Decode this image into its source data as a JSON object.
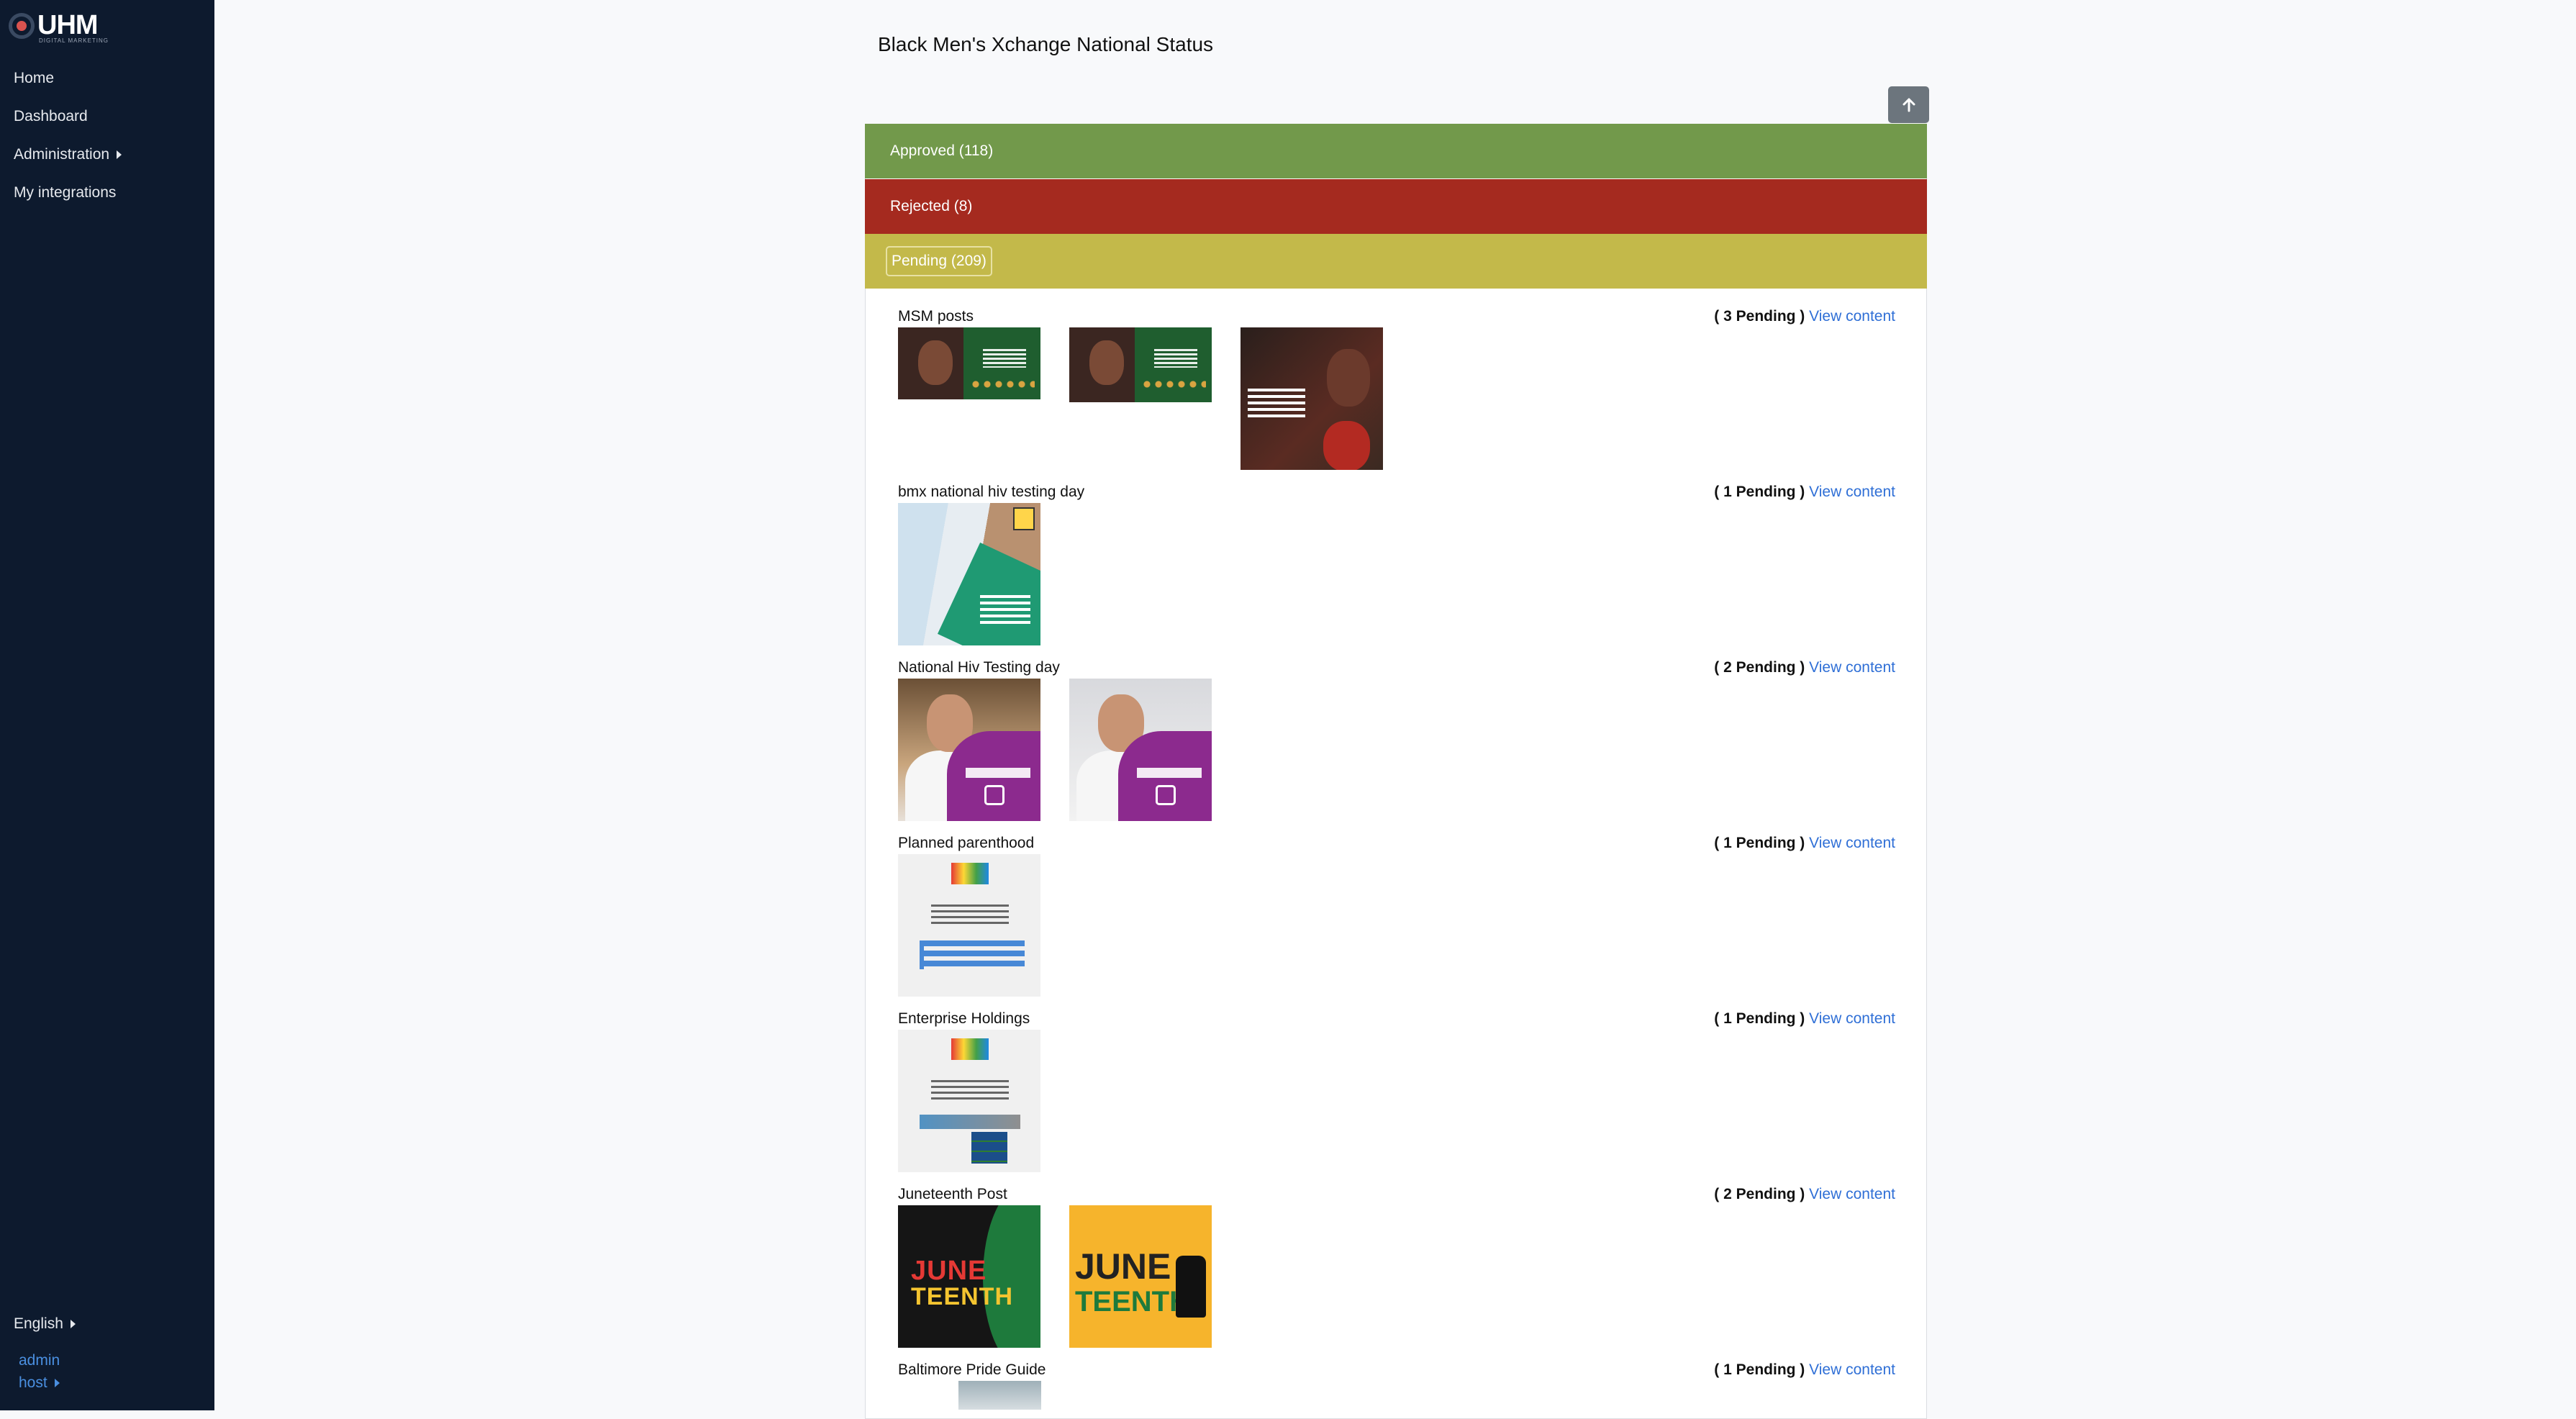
{
  "sidebar": {
    "logo": "UHM",
    "logo_sub": "DIGITAL MARKETING",
    "nav": [
      "Home",
      "Dashboard",
      "Administration",
      "My integrations"
    ],
    "language": "English",
    "user_links": [
      "admin",
      "host"
    ]
  },
  "page": {
    "title": "Black Men's Xchange National Status"
  },
  "status_bars": {
    "approved": "Approved (118)",
    "rejected": "Rejected (8)",
    "pending": "Pending (209)"
  },
  "groups": [
    {
      "name": "MSM posts",
      "count": "( 3 Pending )",
      "link": "View content"
    },
    {
      "name": "bmx national hiv testing day",
      "count": "( 1 Pending )",
      "link": "View content"
    },
    {
      "name": "National Hiv Testing day",
      "count": "( 2 Pending )",
      "link": "View content"
    },
    {
      "name": "Planned parenthood",
      "count": "( 1 Pending )",
      "link": "View content"
    },
    {
      "name": "Enterprise Holdings",
      "count": "( 1 Pending )",
      "link": "View content"
    },
    {
      "name": "Juneteenth Post",
      "count": "( 2 Pending )",
      "link": "View content"
    },
    {
      "name": "Baltimore Pride Guide",
      "count": "( 1 Pending )",
      "link": "View content"
    }
  ],
  "thumbnail_text": {
    "juneteenth_1": [
      "JUNE",
      "TEENTH"
    ],
    "juneteenth_2": [
      "JUNE",
      "TEENTH"
    ]
  },
  "colors": {
    "sidebar_bg": "#0d1a2e",
    "approved": "#72994b",
    "rejected": "#a52a1f",
    "pending": "#c3b94a",
    "link": "#2f6fd6"
  },
  "icons": {
    "scroll_up": "arrow-up-icon",
    "expand": "caret-right-icon"
  }
}
